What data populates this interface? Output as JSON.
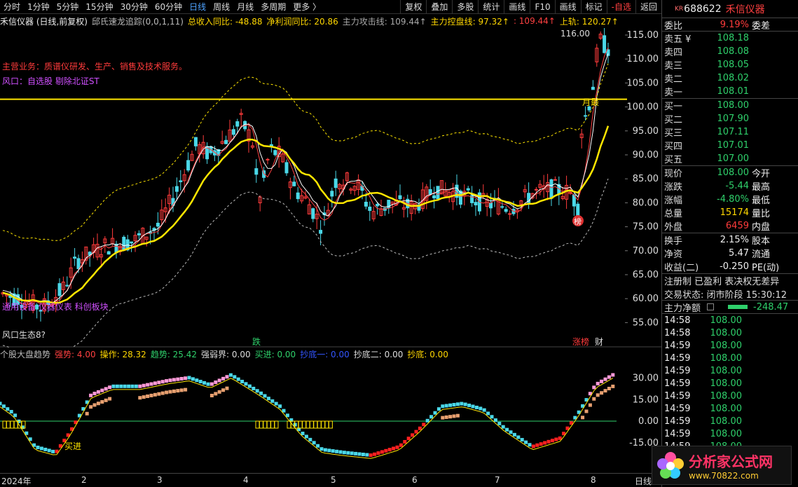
{
  "toolbar": {
    "left_items": [
      "分时",
      "1分钟",
      "5分钟",
      "15分钟",
      "30分钟",
      "60分钟",
      "日线",
      "周线",
      "月线",
      "多周期",
      "更多 〉"
    ],
    "active": "日线",
    "right_items": [
      "复权",
      "叠加",
      "多股",
      "统计",
      "画线",
      "F10",
      "画线",
      "标记",
      "-自选",
      "返回"
    ]
  },
  "info": {
    "name": "禾信仪器 (日线,前复权)",
    "indicator": "邱氏速龙追踪(0,0,1,11)",
    "revenue_label": "总收入同比: -48.88",
    "profit_label": "净利润同比: 20.86",
    "attack_label": "主力攻击线: 109.44↑",
    "control_label": "主力控盘线: 97.32↑",
    "mid_label": ": 109.44↑",
    "upper_label": "上轨: 120.27↑"
  },
  "chart_annotations": {
    "business": "主营业务：质谱仪研发、生产、销售及技术服务。",
    "wind": "风口：自选股 剔除北证ST",
    "peak": "116.00",
    "left_low_label": "通用设备 仪器仪表 科创板块",
    "bottom_left": "风口生态8?",
    "event_fall": "跌",
    "event_limit": "涨榜",
    "event_fin": "财",
    "month_label": "月最",
    "marker": "榜"
  },
  "price_axis": [
    "115.00",
    "110.00",
    "105.00",
    "100.00",
    "95.00",
    "90.00",
    "85.00",
    "80.00",
    "75.00",
    "70.00",
    "65.00",
    "60.00",
    "55.00"
  ],
  "indicator": {
    "name": "个股大盘趋势",
    "strong": "强势: 4.00",
    "operate": "操作: 28.32",
    "trend": "趋势: 25.42",
    "boundary": "强弱界: 0.00",
    "buy": "买进: 0.00",
    "bottom1": "抄底一: 0.00",
    "bottom2": "抄底二: 0.00",
    "bottom3": "抄底: 0.00",
    "axis": [
      "30.00",
      "15.00",
      "0.00",
      "-15.00"
    ],
    "buy_label": "买进"
  },
  "date_axis": [
    "2024年",
    "2",
    "3",
    "4",
    "5",
    "6",
    "7",
    "8",
    "日线"
  ],
  "quote": {
    "code": "688622",
    "prefix": "KR",
    "name": "禾信仪器",
    "webi_label": "委比",
    "webi": "9.19%",
    "wecha_label": "委差",
    "asks": [
      {
        "label": "卖五 ¥",
        "price": "108.18"
      },
      {
        "label": "卖四",
        "price": "108.08"
      },
      {
        "label": "卖三",
        "price": "108.05"
      },
      {
        "label": "卖二",
        "price": "108.02"
      },
      {
        "label": "卖一",
        "price": "108.01"
      }
    ],
    "bids": [
      {
        "label": "买一",
        "price": "108.00"
      },
      {
        "label": "买二",
        "price": "107.90"
      },
      {
        "label": "买三",
        "price": "107.11"
      },
      {
        "label": "买四",
        "price": "107.01"
      },
      {
        "label": "买五",
        "price": "107.00"
      }
    ],
    "stats": [
      {
        "label": "现价",
        "value": "108.00",
        "cls": "down",
        "label2": "今开"
      },
      {
        "label": "涨跌",
        "value": "-5.44",
        "cls": "down",
        "label2": "最高"
      },
      {
        "label": "涨幅",
        "value": "-4.80%",
        "cls": "down",
        "label2": "最低"
      },
      {
        "label": "总量",
        "value": "15174",
        "cls": "yellow",
        "label2": "量比"
      },
      {
        "label": "外盘",
        "value": "6459",
        "cls": "up",
        "label2": "内盘"
      }
    ],
    "stats2": [
      {
        "label": "换手",
        "value": "2.15%",
        "label2": "股本"
      },
      {
        "label": "净资",
        "value": "5.47",
        "label2": "流通"
      },
      {
        "label": "收益(二)",
        "value": "-0.250",
        "label2": "PE(动)"
      }
    ],
    "reg": "注册制 已盈利 表决权无差异",
    "status": "交易状态: 闭市阶段 15:30:12",
    "net_label": "主力净额",
    "net_value": "-248.47",
    "ticks": [
      {
        "t": "14:58",
        "p": "108.00"
      },
      {
        "t": "14:58",
        "p": "108.00"
      },
      {
        "t": "14:59",
        "p": "108.00"
      },
      {
        "t": "14:59",
        "p": "108.00"
      },
      {
        "t": "14:59",
        "p": "108.00"
      },
      {
        "t": "14:59",
        "p": "108.00"
      },
      {
        "t": "14:59",
        "p": "108.00"
      },
      {
        "t": "14:59",
        "p": "108.00"
      },
      {
        "t": "14:59",
        "p": "108.00"
      },
      {
        "t": "14:59",
        "p": "108.00"
      },
      {
        "t": "14:59",
        "p": "108.00"
      }
    ]
  },
  "logo": {
    "title": "分析家公式网",
    "url": "www.70822.com"
  }
}
